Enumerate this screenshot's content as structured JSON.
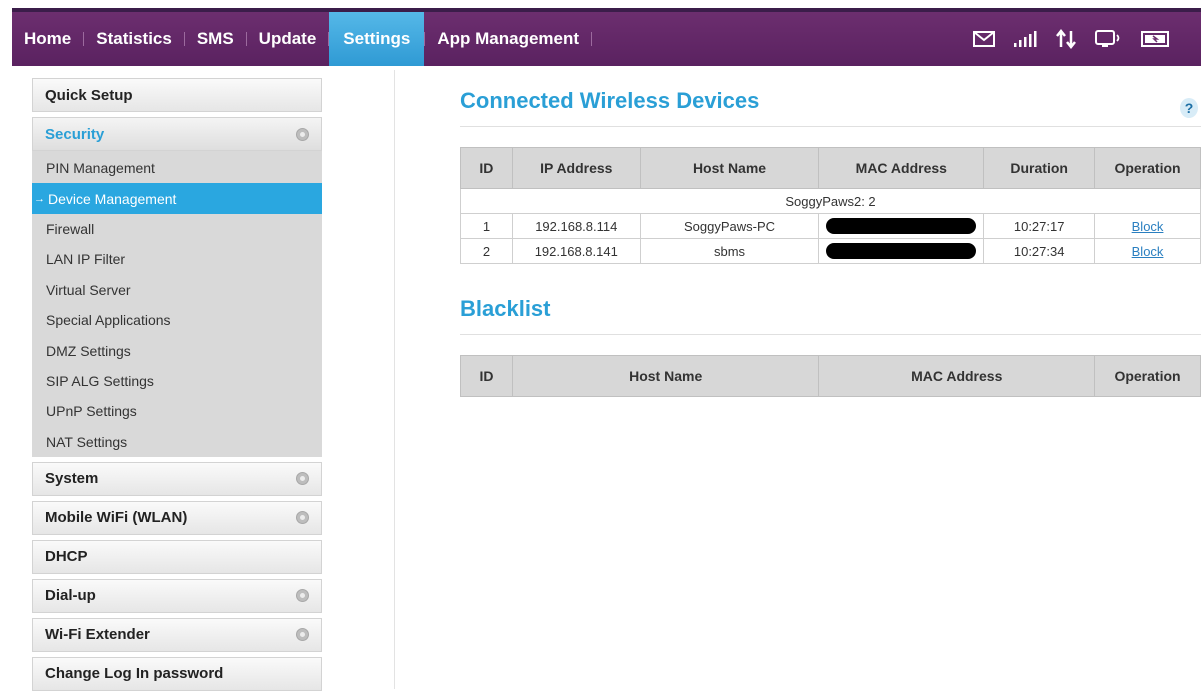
{
  "nav": {
    "items": [
      {
        "label": "Home"
      },
      {
        "label": "Statistics"
      },
      {
        "label": "SMS"
      },
      {
        "label": "Update"
      },
      {
        "label": "Settings"
      },
      {
        "label": "App Management"
      }
    ],
    "active": "Settings",
    "icons": [
      "mail-icon",
      "signal-icon",
      "data-transfer-icon",
      "wifi-device-icon",
      "battery-icon"
    ]
  },
  "sidebar": {
    "quick_setup": "Quick Setup",
    "security": {
      "label": "Security",
      "items": [
        {
          "label": "PIN Management"
        },
        {
          "label": "Device Management"
        },
        {
          "label": "Firewall"
        },
        {
          "label": "LAN IP Filter"
        },
        {
          "label": "Virtual Server"
        },
        {
          "label": "Special Applications"
        },
        {
          "label": "DMZ Settings"
        },
        {
          "label": "SIP ALG Settings"
        },
        {
          "label": "UPnP Settings"
        },
        {
          "label": "NAT Settings"
        }
      ],
      "active_index": 1
    },
    "system": "System",
    "wlan": "Mobile WiFi (WLAN)",
    "dhcp": "DHCP",
    "dialup": "Dial-up",
    "extender": "Wi-Fi Extender",
    "password": "Change Log In password"
  },
  "main": {
    "help": "?",
    "connected": {
      "title": "Connected Wireless Devices",
      "headers": {
        "id": "ID",
        "ip": "IP Address",
        "host": "Host Name",
        "mac": "MAC Address",
        "duration": "Duration",
        "operation": "Operation"
      },
      "group": "SoggyPaws2:  2",
      "rows": [
        {
          "id": "1",
          "ip": "192.168.8.114",
          "host": "SoggyPaws-PC",
          "duration": "10:27:17",
          "operation": "Block"
        },
        {
          "id": "2",
          "ip": "192.168.8.141",
          "host": "sbms",
          "duration": "10:27:34",
          "operation": "Block"
        }
      ]
    },
    "blacklist": {
      "title": "Blacklist",
      "headers": {
        "id": "ID",
        "host": "Host Name",
        "mac": "MAC Address",
        "operation": "Operation"
      }
    }
  }
}
